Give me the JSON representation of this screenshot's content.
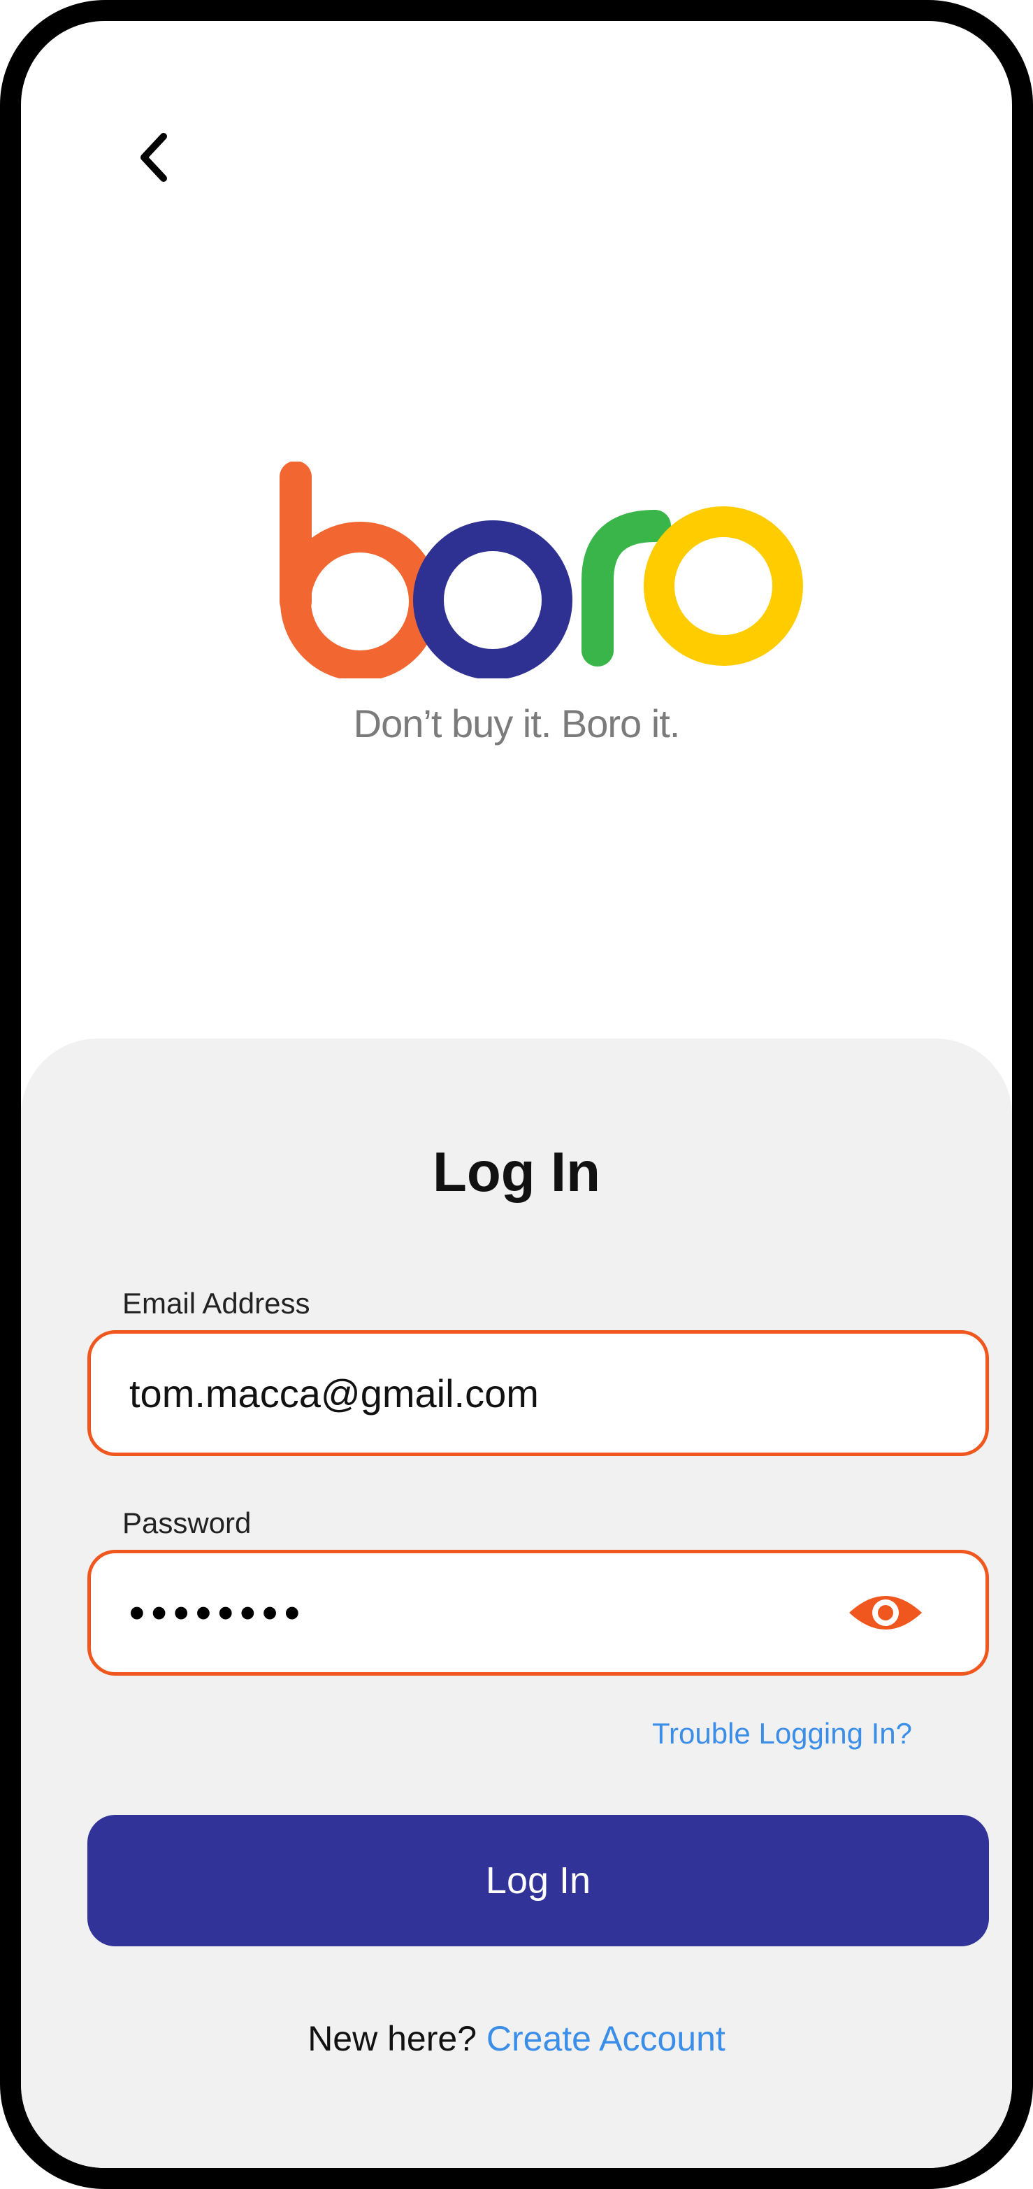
{
  "brand": {
    "logo_text": "boro",
    "tagline": "Don’t buy it. Boro it.",
    "colors": {
      "b": "#f26631",
      "o1": "#2e3192",
      "r": "#39b54a",
      "o2": "#ffcc00"
    }
  },
  "nav": {
    "back_icon": "chevron-left-icon"
  },
  "login_form": {
    "title": "Log In",
    "email_label": "Email Address",
    "email_value": "tom.macca@gmail.com",
    "password_label": "Password",
    "password_value": "••••••••",
    "show_password_icon": "eye-icon",
    "trouble_link": "Trouble Logging In?",
    "submit_label": "Log In",
    "signup_prompt": "New here?",
    "signup_link": "Create Account"
  },
  "colors": {
    "accent_orange": "#f0571f",
    "primary_button": "#313399",
    "link": "#3b8ee8",
    "sheet_background": "#f1f1f1"
  }
}
